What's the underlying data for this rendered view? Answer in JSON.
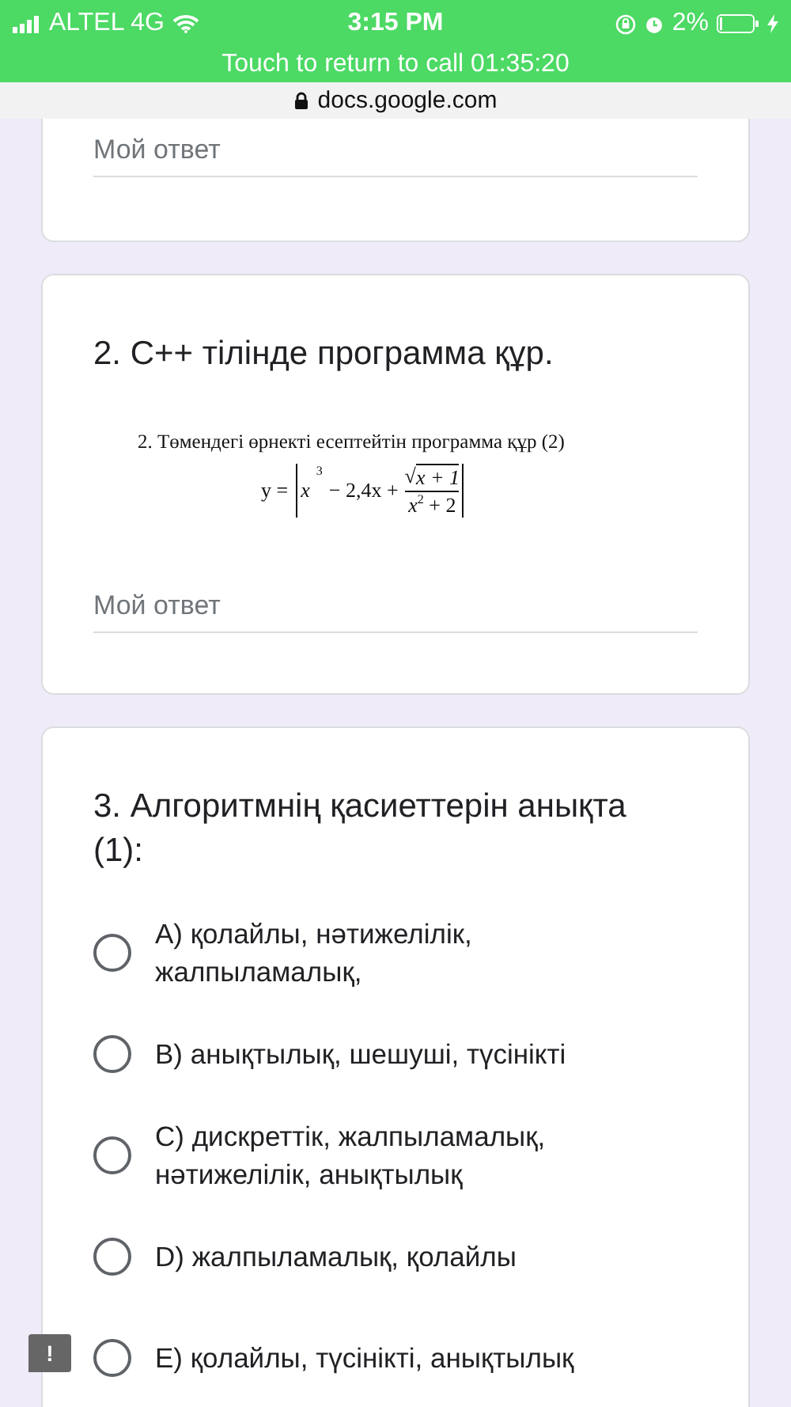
{
  "status_bar": {
    "carrier": "ALTEL 4G",
    "time": "3:15 PM",
    "battery": "2%"
  },
  "call_banner": {
    "text": "Touch to return to call 01:35:20"
  },
  "address_bar": {
    "url": "docs.google.com"
  },
  "questions": [
    {
      "kind": "text",
      "answer": {
        "placeholder": "Мой ответ"
      }
    },
    {
      "kind": "text",
      "title": "2. C++ тілінде программа құр.",
      "image": {
        "caption": "2. Төмендегі өрнекті есептейтін программа құр (2)",
        "formula": {
          "lhs": "y =",
          "term1": "x",
          "exp1": "3",
          "term2": "− 2,4x +",
          "root": "√",
          "numerator": "x + 1",
          "denominator": "x",
          "exp2": "2",
          "den_rest": "+ 2"
        }
      },
      "answer": {
        "placeholder": "Мой ответ"
      }
    },
    {
      "kind": "choice",
      "title": "3. Алгоритмнің қасиеттерін анықта (1):",
      "options": [
        {
          "label": "A) қолайлы, нәтижелілік, жалпыламалық,",
          "selected": false
        },
        {
          "label": "B) анықтылық, шешуші, түсінікті",
          "selected": false
        },
        {
          "label": "C) дискреттік, жалпыламалық, нәтижелілік, анықтылық",
          "selected": false
        },
        {
          "label": "D) жалпыламалық, қолайлы",
          "selected": false
        },
        {
          "label": "E) қолайлы, түсінікті, анықтылық",
          "selected": false
        }
      ]
    }
  ],
  "feedback_button": {
    "label": "!"
  }
}
